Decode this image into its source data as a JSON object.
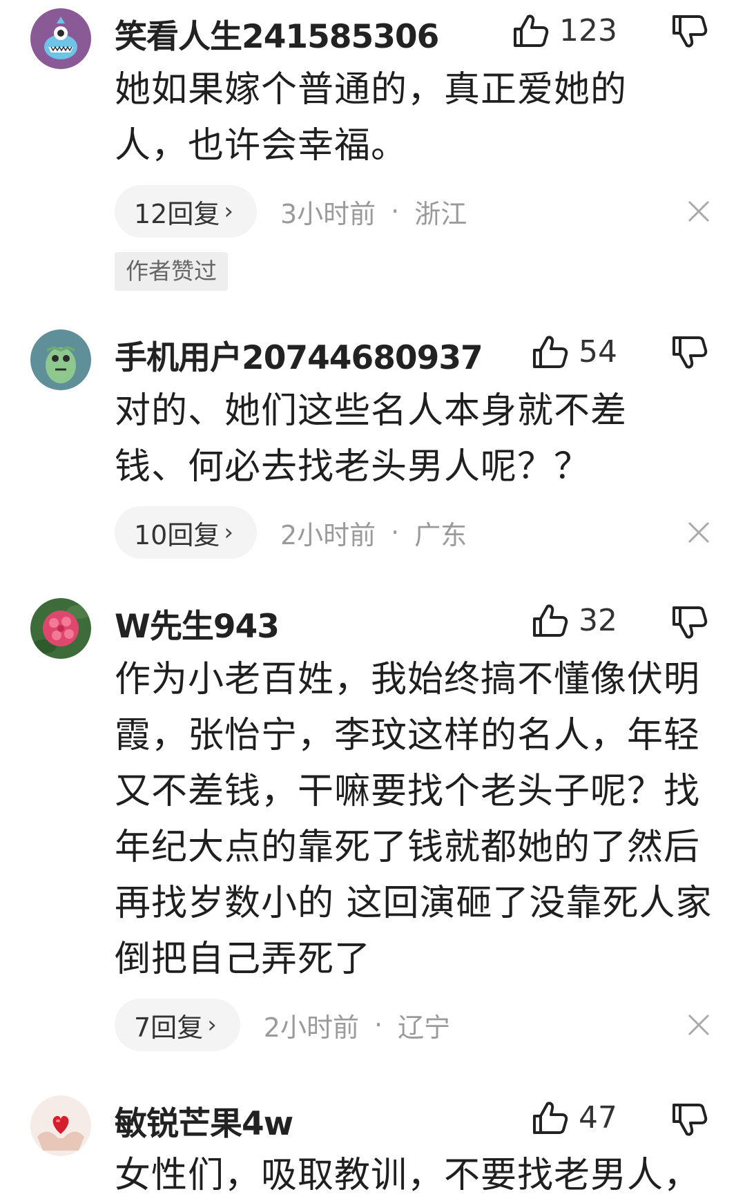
{
  "comments": [
    {
      "username": "笑看人生241585306",
      "likes": "123",
      "body": "她如果嫁个普通的，真正爱她的人，也许会幸福。",
      "replies": "12回复",
      "reply_chevron": "›",
      "time": "3小时前",
      "separator": "·",
      "region": "浙江",
      "badge": "作者赞过",
      "avatar_icon": "cartoon-monster-avatar"
    },
    {
      "username": "手机用户20744680937",
      "likes": "54",
      "body": "对的、她们这些名人本身就不差钱、何必去找老头男人呢？？",
      "replies": "10回复",
      "reply_chevron": "›",
      "time": "2小时前",
      "separator": "·",
      "region": "广东",
      "avatar_icon": "green-creature-avatar"
    },
    {
      "username": "W先生943",
      "likes": "32",
      "body": "作为小老百姓，我始终搞不懂像伏明霞，张怡宁，李玟这样的名人，年轻又不差钱，干嘛要找个老头子呢？找年纪大点的靠死了钱就都她的了然后再找岁数小的 这回演砸了没靠死人家倒把自己弄死了",
      "replies": "7回复",
      "reply_chevron": "›",
      "time": "2小时前",
      "separator": "·",
      "region": "辽宁",
      "avatar_icon": "pink-flower-avatar"
    },
    {
      "username": "敏锐芒果4w",
      "likes": "47",
      "body": "女性们，吸取教训，不要找老男人，",
      "avatar_icon": "heart-in-hands-avatar"
    }
  ],
  "icons": {
    "like": "thumbs-up-icon",
    "dislike": "thumbs-down-icon",
    "close": "close-icon"
  },
  "colors": {
    "background": "#ffffff",
    "pill": "#f4f4f4",
    "meta_text": "#9a9a9a",
    "badge_bg": "#eeeeee"
  }
}
